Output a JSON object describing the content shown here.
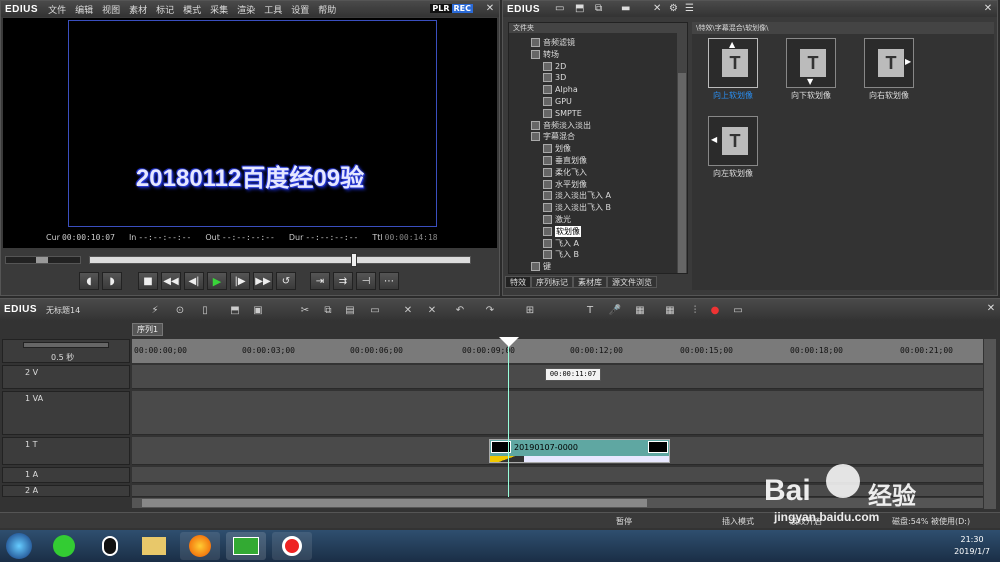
{
  "monitor": {
    "logo": "EDIUS",
    "menu": [
      "文件",
      "编辑",
      "视图",
      "素材",
      "标记",
      "模式",
      "采集",
      "渲染",
      "工具",
      "设置",
      "帮助"
    ],
    "plr": "PLR",
    "rec": "REC",
    "overlay_title": "20180112百度经09验",
    "timecodes": {
      "cur_label": "Cur",
      "cur": "00:00:10:07",
      "in_label": "In",
      "in": "--:--:--:--",
      "out_label": "Out",
      "out": "--:--:--:--",
      "dur_label": "Dur",
      "dur": "--:--:--:--",
      "ttl_label": "Ttl",
      "ttl": "00:00:14:18"
    }
  },
  "bin": {
    "logo": "EDIUS",
    "tree_header": "文件夹",
    "tree": [
      {
        "label": "音频滤镜",
        "level": 1
      },
      {
        "label": "转场",
        "level": 1
      },
      {
        "label": "2D",
        "level": 2
      },
      {
        "label": "3D",
        "level": 2
      },
      {
        "label": "Alpha",
        "level": 2
      },
      {
        "label": "GPU",
        "level": 2
      },
      {
        "label": "SMPTE",
        "level": 2
      },
      {
        "label": "音频淡入淡出",
        "level": 1
      },
      {
        "label": "字幕混合",
        "level": 1
      },
      {
        "label": "划像",
        "level": 2
      },
      {
        "label": "垂直划像",
        "level": 2
      },
      {
        "label": "柔化飞入",
        "level": 2
      },
      {
        "label": "水平划像",
        "level": 2
      },
      {
        "label": "淡入淡出飞入 A",
        "level": 2
      },
      {
        "label": "淡入淡出飞入 B",
        "level": 2
      },
      {
        "label": "激光",
        "level": 2
      },
      {
        "label": "软划像",
        "level": 2,
        "selected": true
      },
      {
        "label": "飞入 A",
        "level": 2
      },
      {
        "label": "飞入 B",
        "level": 2
      },
      {
        "label": "键",
        "level": 1
      }
    ],
    "path": "\\特效\\字幕混合\\软划像\\",
    "tabs": [
      "特效",
      "序列标记",
      "素材库",
      "源文件浏览"
    ],
    "items": [
      {
        "label": "向上软划像",
        "selected": true
      },
      {
        "label": "向下软划像"
      },
      {
        "label": "向右软划像"
      },
      {
        "label": "向左软划像"
      }
    ]
  },
  "timeline": {
    "logo": "EDIUS",
    "project_name": "无标题14",
    "sequence_tab": "序列1",
    "zoom": "0.5 秒",
    "ruler": [
      "00:00:00;00",
      "00:00:03;00",
      "00:00:06;00",
      "00:00:09;00",
      "00:00:12;00",
      "00:00:15;00",
      "00:00:18;00",
      "00:00:21;00"
    ],
    "tooltip": "00:00:11:07",
    "tracks": [
      {
        "name": "2 V"
      },
      {
        "name": "1 VA"
      },
      {
        "name": "1 T"
      },
      {
        "name": "1 A"
      },
      {
        "name": "2 A"
      }
    ],
    "title_clip": "20190107-0000"
  },
  "status": {
    "pause": "暂停",
    "insert_mode": "插入模式",
    "ripple": "波纹开启",
    "disk": "磁盘:54% 被使用(D:)"
  },
  "taskbar": {
    "time": "21:30",
    "date": "2019/1/7"
  },
  "watermark": {
    "brand": "Bai",
    "brand2": "经验",
    "url": "jingyan.baidu.com"
  }
}
